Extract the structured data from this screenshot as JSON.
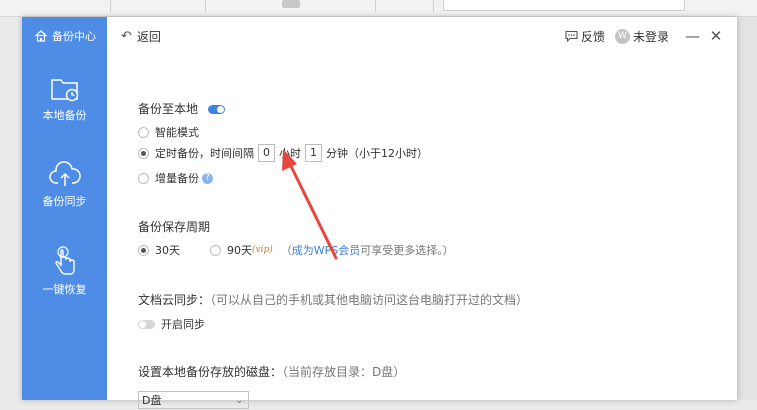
{
  "sidebar": {
    "header_label": "备份中心",
    "items": [
      {
        "label": "本地备份",
        "icon": "folder-clock-icon"
      },
      {
        "label": "备份同步",
        "icon": "cloud-upload-icon"
      },
      {
        "label": "一键恢复",
        "icon": "hand-tap-icon"
      }
    ]
  },
  "titlebar": {
    "back_label": "返回",
    "feedback_label": "反馈",
    "avatar_letter": "W",
    "login_label": "未登录"
  },
  "local_backup": {
    "title": "备份至本地",
    "toggle_on": true,
    "opt_smart": "智能模式",
    "opt_timed_prefix": "定时备份，时间间隔",
    "hours_value": "0",
    "hours_unit": "小时",
    "minutes_value": "1",
    "minutes_unit": "分钟（小于12小时）",
    "opt_incremental": "增量备份",
    "help_icon_glyph": "?"
  },
  "retention": {
    "title": "备份保存周期",
    "opt_30": "30天",
    "opt_90": "90天",
    "vip_tag": "(vip)",
    "note_open": "（",
    "note_link": "成为WPS会员",
    "note_rest": " 可享受更多选择。）"
  },
  "cloud_sync": {
    "title": "文档云同步：",
    "note": "（可以从自己的手机或其他电脑访问这台电脑打开过的文档）",
    "toggle_label": "开启同步",
    "toggle_on": false
  },
  "disk": {
    "title": "设置本地备份存放的磁盘：",
    "note": "（当前存放目录：D盘）",
    "selected": "D盘"
  },
  "colors": {
    "sidebar_bg": "#4f8ce6",
    "accent": "#3f82e6",
    "annotation_arrow": "#e8453c"
  }
}
